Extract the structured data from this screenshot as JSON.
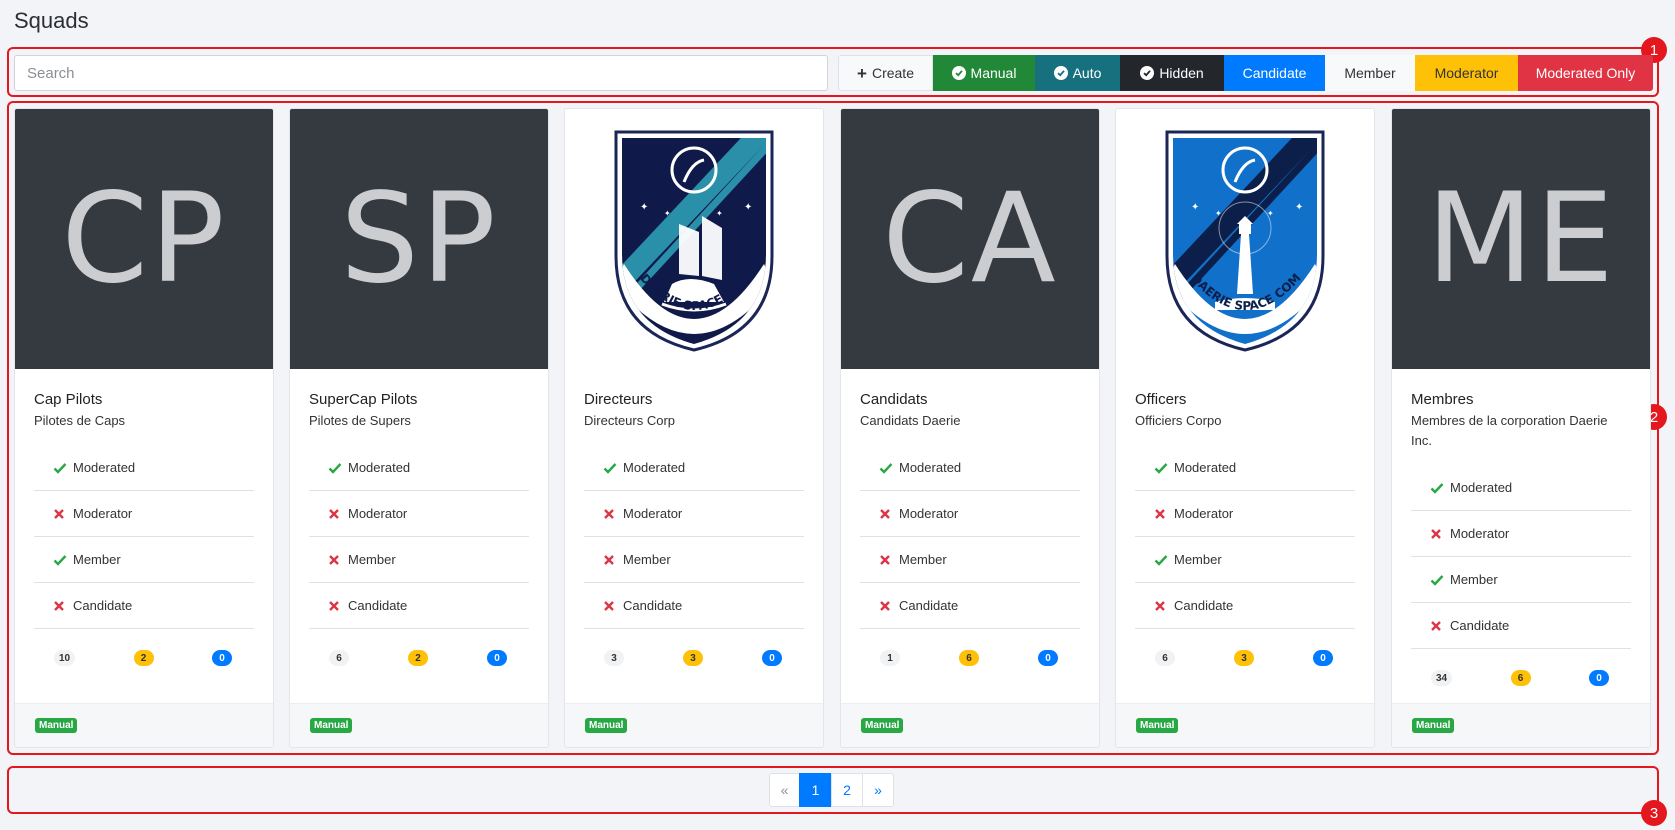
{
  "page": {
    "title": "Squads"
  },
  "annotations": [
    "1",
    "2",
    "3"
  ],
  "search": {
    "placeholder": "Search",
    "value": ""
  },
  "filters": {
    "create": "Create",
    "manual": "Manual",
    "auto": "Auto",
    "hidden": "Hidden",
    "candidate": "Candidate",
    "member": "Member",
    "moderator": "Moderator",
    "moderated_only": "Moderated Only"
  },
  "colors": {
    "manual": "#218838",
    "auto": "#17707e",
    "hidden": "#23272b",
    "candidate": "#007bff",
    "member": "#f8f9fa",
    "moderator": "#ffc107",
    "moderated_only": "#e03444",
    "check": "#28a745",
    "cross": "#dc3545"
  },
  "perm_labels": {
    "moderated": "Moderated",
    "moderator": "Moderator",
    "member": "Member",
    "candidate": "Candidate"
  },
  "cards": [
    {
      "initials": "CP",
      "logo": false,
      "title": "Cap Pilots",
      "subtitle": "Pilotes de Caps",
      "moderated": true,
      "moderator": false,
      "member": true,
      "candidate": false,
      "counts": [
        "10",
        "2",
        "0"
      ],
      "tag": "Manual"
    },
    {
      "initials": "SP",
      "logo": false,
      "title": "SuperCap Pilots",
      "subtitle": "Pilotes de Supers",
      "moderated": true,
      "moderator": false,
      "member": false,
      "candidate": false,
      "counts": [
        "6",
        "2",
        "0"
      ],
      "tag": "Manual"
    },
    {
      "initials": "",
      "logo": "ship-badge",
      "title": "Directeurs",
      "subtitle": "Directeurs Corp",
      "moderated": true,
      "moderator": false,
      "member": false,
      "candidate": false,
      "counts": [
        "3",
        "3",
        "0"
      ],
      "tag": "Manual"
    },
    {
      "initials": "CA",
      "logo": false,
      "title": "Candidats",
      "subtitle": "Candidats Daerie",
      "moderated": true,
      "moderator": false,
      "member": false,
      "candidate": false,
      "counts": [
        "1",
        "6",
        "0"
      ],
      "tag": "Manual"
    },
    {
      "initials": "",
      "logo": "lighthouse-badge",
      "title": "Officers",
      "subtitle": "Officiers Corpo",
      "moderated": true,
      "moderator": false,
      "member": true,
      "candidate": false,
      "counts": [
        "6",
        "3",
        "0"
      ],
      "tag": "Manual"
    },
    {
      "initials": "ME",
      "logo": false,
      "title": "Membres",
      "subtitle": "Membres de la corporation Daerie Inc.",
      "moderated": true,
      "moderator": false,
      "member": true,
      "candidate": false,
      "counts": [
        "34",
        "6",
        "0"
      ],
      "tag": "Manual"
    }
  ],
  "badge_text": "DAERIE SPACE COMMAND",
  "pagination": {
    "prev": "«",
    "pages": [
      "1",
      "2"
    ],
    "active": "1",
    "next": "»"
  }
}
